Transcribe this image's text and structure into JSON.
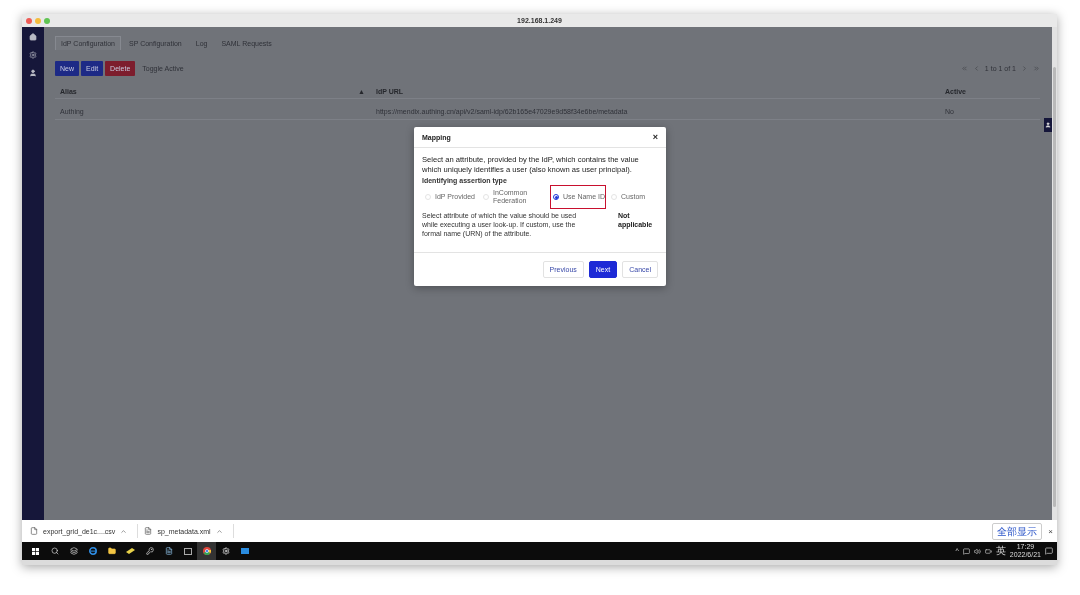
{
  "window": {
    "title": "192.168.1.249"
  },
  "sidebar": {
    "items": [
      {
        "kind": "home",
        "selected": false
      },
      {
        "kind": "settings",
        "selected": false
      },
      {
        "kind": "user",
        "selected": false
      }
    ]
  },
  "tabs": [
    {
      "label": "IdP Configuration",
      "selected": true
    },
    {
      "label": "SP Configuration",
      "selected": false
    },
    {
      "label": "Log",
      "selected": false
    },
    {
      "label": "SAML Requests",
      "selected": false
    }
  ],
  "toolbar": [
    {
      "label": "New",
      "kind": "primary"
    },
    {
      "label": "Edit",
      "kind": "primary"
    },
    {
      "label": "Delete",
      "kind": "danger"
    },
    {
      "label": "Toggle Active",
      "kind": "plain"
    }
  ],
  "pagination": {
    "text": "1 to 1 of 1"
  },
  "table": {
    "columns": [
      {
        "label": "Alias",
        "sort_arrow": "▲"
      },
      {
        "label": "IdP URL"
      },
      {
        "label": "Active"
      }
    ],
    "rows": [
      [
        "Authing",
        "https://mendix.authing.cn/api/v2/saml-idp/62b165e47029e9d58f34e6be/metadata",
        "No"
      ]
    ]
  },
  "dialog": {
    "title": "Mapping",
    "close": "×",
    "intro": "Select an attribute, provided by the IdP, which contains the value which uniquely identifies a user (also known as user principal).",
    "group_label": "Identifying assertion type",
    "options": [
      {
        "label": "IdP Provided",
        "selected": false,
        "highlighted": false
      },
      {
        "label": "InCommon Federation",
        "selected": false,
        "highlighted": false
      },
      {
        "label": "Use Name ID",
        "selected": true,
        "highlighted": true
      },
      {
        "label": "Custom",
        "selected": false,
        "highlighted": false
      }
    ],
    "help": "Select attribute of which the value should be used while executing a user look-up. If custom, use the formal name (URN) of the attribute.",
    "value": "Not applicable",
    "buttons": [
      {
        "label": "Previous",
        "kind": "secondary"
      },
      {
        "label": "Next",
        "kind": "primary"
      },
      {
        "label": "Cancel",
        "kind": "secondary"
      }
    ]
  },
  "downloads": {
    "items": [
      {
        "name": "export_grid_de1c....csv",
        "kind": "csv"
      },
      {
        "name": "sp_metadata.xml",
        "kind": "xml"
      }
    ],
    "show_all": "全部显示",
    "close": "×"
  },
  "taskbar": {
    "apps": [
      {
        "kind": "start",
        "selected": false
      },
      {
        "kind": "search",
        "selected": false
      },
      {
        "kind": "taskview",
        "selected": false
      },
      {
        "kind": "edge",
        "selected": false
      },
      {
        "kind": "explorer",
        "selected": false
      },
      {
        "kind": "app",
        "selected": false
      },
      {
        "kind": "keys",
        "selected": false
      },
      {
        "kind": "notes",
        "selected": false
      },
      {
        "kind": "terminal",
        "selected": false
      },
      {
        "kind": "chrome",
        "selected": true
      },
      {
        "kind": "settings",
        "selected": false
      },
      {
        "kind": "mail",
        "selected": false
      }
    ],
    "tray_chevron": "^",
    "ime": "英",
    "time": "17:29",
    "date": "2022/6/21"
  }
}
